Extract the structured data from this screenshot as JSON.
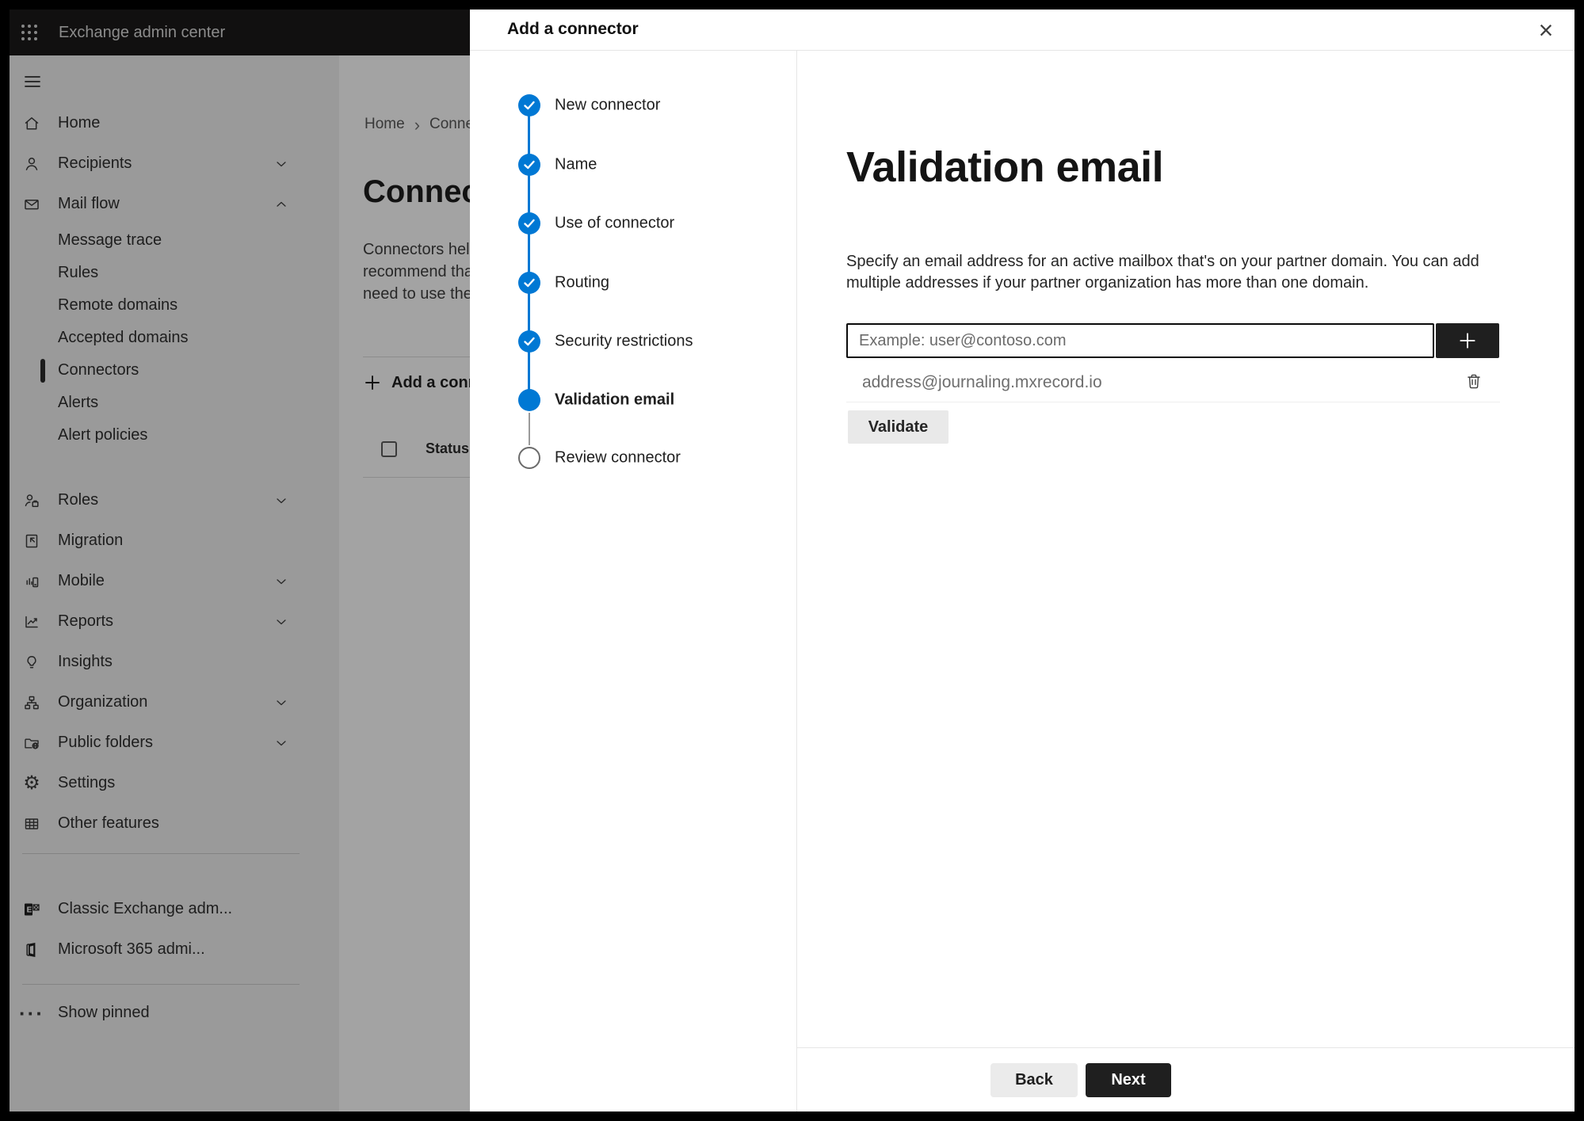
{
  "topbar": {
    "app_title": "Exchange admin center"
  },
  "sidebar": {
    "items": [
      {
        "label": "Home",
        "icon": "home-icon"
      },
      {
        "label": "Recipients",
        "icon": "person-icon",
        "chevron": "down"
      },
      {
        "label": "Mail flow",
        "icon": "mail-icon",
        "chevron": "up",
        "expanded": true
      },
      {
        "label": "Message trace",
        "sub": true
      },
      {
        "label": "Rules",
        "sub": true
      },
      {
        "label": "Remote domains",
        "sub": true
      },
      {
        "label": "Accepted domains",
        "sub": true
      },
      {
        "label": "Connectors",
        "sub": true,
        "selected": true
      },
      {
        "label": "Alerts",
        "sub": true
      },
      {
        "label": "Alert policies",
        "sub": true
      },
      {
        "label": "Roles",
        "icon": "roles-icon",
        "chevron": "down"
      },
      {
        "label": "Migration",
        "icon": "migration-icon"
      },
      {
        "label": "Mobile",
        "icon": "mobile-icon",
        "chevron": "down"
      },
      {
        "label": "Reports",
        "icon": "reports-icon",
        "chevron": "down"
      },
      {
        "label": "Insights",
        "icon": "insights-icon"
      },
      {
        "label": "Organization",
        "icon": "organization-icon",
        "chevron": "down"
      },
      {
        "label": "Public folders",
        "icon": "public-folders-icon",
        "chevron": "down"
      },
      {
        "label": "Settings",
        "icon": "gear-icon"
      },
      {
        "label": "Other features",
        "icon": "grid-icon"
      },
      {
        "label": "Classic Exchange adm...",
        "icon": "exchange-logo-icon"
      },
      {
        "label": "Microsoft 365 admi...",
        "icon": "office-logo-icon"
      },
      {
        "label": "Show pinned",
        "icon": "ellipsis-icon"
      }
    ]
  },
  "page": {
    "breadcrumb": {
      "home": "Home",
      "current": "Conne"
    },
    "heading": "Connec",
    "intro_lines": [
      "Connectors help",
      "recommend that",
      "need to use ther"
    ],
    "add_connector_label": "Add a conn",
    "table": {
      "status_header": "Status"
    }
  },
  "modal": {
    "header": {
      "title": "Add a connector",
      "close_glyph": "×"
    },
    "steps": [
      {
        "label": "New connector",
        "state": "completed"
      },
      {
        "label": "Name",
        "state": "completed"
      },
      {
        "label": "Use of connector",
        "state": "completed"
      },
      {
        "label": "Routing",
        "state": "completed"
      },
      {
        "label": "Security restrictions",
        "state": "completed"
      },
      {
        "label": "Validation email",
        "state": "current"
      },
      {
        "label": "Review connector",
        "state": "upcoming"
      }
    ],
    "body": {
      "title": "Validation email",
      "description": "Specify an email address for an active mailbox that's on your partner domain. You can add multiple addresses if your partner organization has more than one domain.",
      "email_placeholder": "Example: user@contoso.com",
      "addresses": [
        "address@journaling.mxrecord.io"
      ],
      "validate_label": "Validate"
    },
    "footer": {
      "back_label": "Back",
      "next_label": "Next"
    }
  },
  "icons": {
    "gear_glyph": "⚙",
    "ellipsis_glyph": "···",
    "breadcrumb_separator": "›"
  },
  "colors": {
    "accent_blue": "#0078d4",
    "dark_button": "#1f1f1f",
    "topbar": "#1b1a19"
  }
}
